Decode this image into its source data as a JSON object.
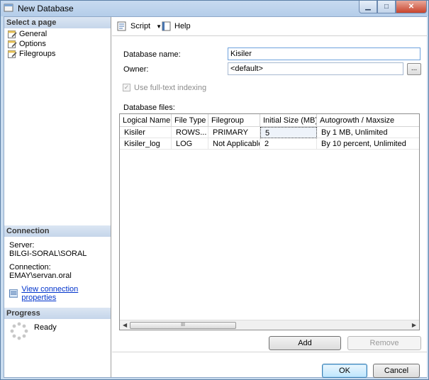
{
  "window": {
    "title": "New Database"
  },
  "left_panel": {
    "select_page_header": "Select a page",
    "pages": [
      {
        "label": "General",
        "icon": "page-wrench-icon"
      },
      {
        "label": "Options",
        "icon": "page-wrench-icon"
      },
      {
        "label": "Filegroups",
        "icon": "page-wrench-icon"
      }
    ],
    "connection_header": "Connection",
    "server_label": "Server:",
    "server_value": "BILGI-SORAL\\SORAL",
    "connection_label": "Connection:",
    "connection_value": "EMAY\\servan.oral",
    "view_connection_link": "View connection properties",
    "progress_header": "Progress",
    "progress_status": "Ready"
  },
  "toolbar": {
    "script_label": "Script",
    "help_label": "Help"
  },
  "form": {
    "database_name_label": "Database name:",
    "database_name_value": "Kisiler",
    "owner_label": "Owner:",
    "owner_value": "<default>",
    "owner_browse_label": "...",
    "fulltext_label": "Use full-text indexing",
    "fulltext_checked": true,
    "database_files_label": "Database files:"
  },
  "files_table": {
    "columns": [
      "Logical Name",
      "File Type",
      "Filegroup",
      "Initial Size (MB)",
      "Autogrowth / Maxsize"
    ],
    "rows": [
      [
        "Kisiler",
        "ROWS...",
        "PRIMARY",
        "5",
        "By 1 MB, Unlimited"
      ],
      [
        "Kisiler_log",
        "LOG",
        "Not Applicable",
        "2",
        "By 10 percent, Unlimited"
      ]
    ],
    "scroll_grip": "III"
  },
  "buttons": {
    "add": "Add",
    "remove": "Remove",
    "ok": "OK",
    "cancel": "Cancel"
  }
}
